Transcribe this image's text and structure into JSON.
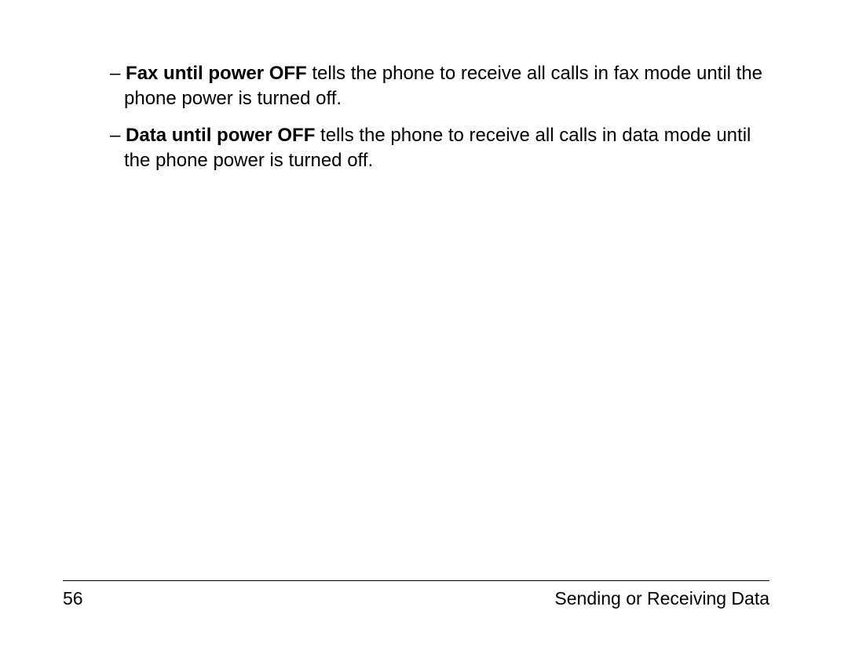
{
  "content": {
    "items": [
      {
        "dash": "–",
        "term": "Fax until power OFF",
        "description": " tells the phone to receive all calls in fax mode until the phone power is turned off."
      },
      {
        "dash": "–",
        "term": "Data until power OFF",
        "description": " tells the phone to receive all calls in data mode until the phone power is turned off."
      }
    ]
  },
  "footer": {
    "page_number": "56",
    "section_title": "Sending or Receiving Data"
  }
}
